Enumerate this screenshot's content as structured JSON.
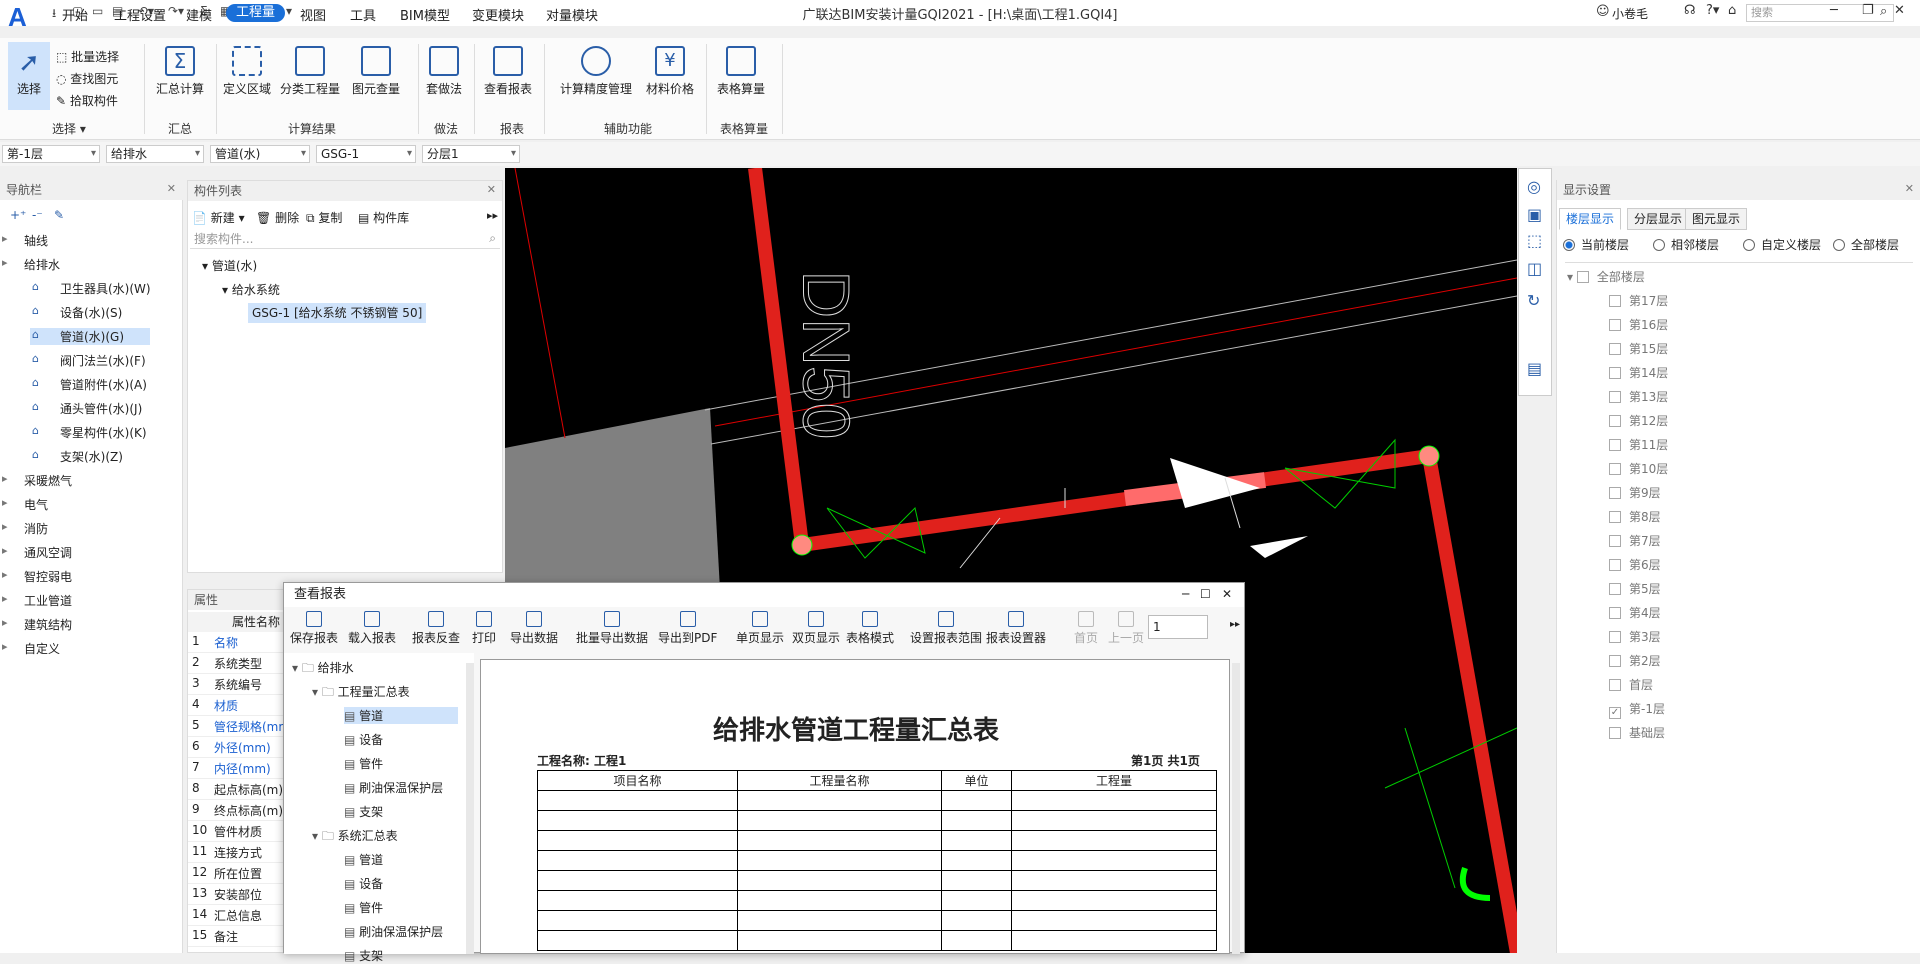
{
  "app": {
    "title": "广联达BIM安装计量GQI2021 - [H:\\桌面\\工程1.GQI4]",
    "logo": "A",
    "user": "小卷毛",
    "search_placeholder": "搜索"
  },
  "menu": [
    "开始",
    "工程设置",
    "建模",
    "工程量",
    "视图",
    "工具",
    "BIM模型",
    "变更模块",
    "对量模块"
  ],
  "menu_active": 3,
  "ribbon": {
    "select": {
      "big": "选择",
      "small": [
        "批量选择",
        "查找图元",
        "拾取构件"
      ],
      "group": "选择"
    },
    "summary": {
      "big": "汇总计算",
      "group": "汇总"
    },
    "results": {
      "items": [
        "定义区域",
        "分类工程量",
        "图元查量"
      ],
      "group": "计算结果"
    },
    "method": {
      "items": [
        "套做法"
      ],
      "group": "做法"
    },
    "report": {
      "items": [
        "查看报表"
      ],
      "group": "报表"
    },
    "aux": {
      "items": [
        "计算精度管理",
        "材料价格"
      ],
      "group": "辅助功能"
    },
    "table": {
      "items": [
        "表格算量"
      ],
      "group": "表格算量"
    }
  },
  "propbar": [
    "第-1层",
    "给排水",
    "管道(水)",
    "GSG-1",
    "分层1"
  ],
  "nav": {
    "title": "导航栏",
    "items": [
      {
        "label": "轴线",
        "level": 0
      },
      {
        "label": "给排水",
        "level": 0
      },
      {
        "label": "卫生器具(水)(W)",
        "level": 1
      },
      {
        "label": "设备(水)(S)",
        "level": 1
      },
      {
        "label": "管道(水)(G)",
        "level": 1,
        "selected": true
      },
      {
        "label": "阀门法兰(水)(F)",
        "level": 1
      },
      {
        "label": "管道附件(水)(A)",
        "level": 1
      },
      {
        "label": "通头管件(水)(J)",
        "level": 1
      },
      {
        "label": "零星构件(水)(K)",
        "level": 1
      },
      {
        "label": "支架(水)(Z)",
        "level": 1
      },
      {
        "label": "采暖燃气",
        "level": 0
      },
      {
        "label": "电气",
        "level": 0
      },
      {
        "label": "消防",
        "level": 0
      },
      {
        "label": "通风空调",
        "level": 0
      },
      {
        "label": "智控弱电",
        "level": 0
      },
      {
        "label": "工业管道",
        "level": 0
      },
      {
        "label": "建筑结构",
        "level": 0
      },
      {
        "label": "自定义",
        "level": 0
      }
    ]
  },
  "components": {
    "title": "构件列表",
    "toolbar": [
      "新建",
      "删除",
      "复制",
      "构件库"
    ],
    "search_placeholder": "搜索构件...",
    "tree": [
      "管道(水)",
      "给水系统",
      "GSG-1 [给水系统 不锈钢管 50]"
    ]
  },
  "properties": {
    "title": "属性",
    "header": "属性名称",
    "rows": [
      {
        "n": "1",
        "name": "名称",
        "blue": true
      },
      {
        "n": "2",
        "name": "系统类型"
      },
      {
        "n": "3",
        "name": "系统编号"
      },
      {
        "n": "4",
        "name": "材质",
        "blue": true
      },
      {
        "n": "5",
        "name": "管径规格(mm",
        "blue": true
      },
      {
        "n": "6",
        "name": "外径(mm)",
        "blue": true
      },
      {
        "n": "7",
        "name": "内径(mm)",
        "blue": true
      },
      {
        "n": "8",
        "name": "起点标高(m)"
      },
      {
        "n": "9",
        "name": "终点标高(m)"
      },
      {
        "n": "10",
        "name": "管件材质"
      },
      {
        "n": "11",
        "name": "连接方式"
      },
      {
        "n": "12",
        "name": "所在位置"
      },
      {
        "n": "13",
        "name": "安装部位"
      },
      {
        "n": "14",
        "name": "汇总信息"
      },
      {
        "n": "15",
        "name": "备注"
      }
    ]
  },
  "canvas": {
    "labels": [
      "DN50"
    ]
  },
  "display": {
    "title": "显示设置",
    "tabs": [
      "楼层显示",
      "分层显示",
      "图元显示"
    ],
    "radios": [
      "当前楼层",
      "相邻楼层",
      "自定义楼层",
      "全部楼层"
    ],
    "all_floors": "全部楼层",
    "floors": [
      "第17层",
      "第16层",
      "第15层",
      "第14层",
      "第13层",
      "第12层",
      "第11层",
      "第10层",
      "第9层",
      "第8层",
      "第7层",
      "第6层",
      "第5层",
      "第4层",
      "第3层",
      "第2层",
      "首层",
      "第-1层",
      "基础层"
    ],
    "checked": "第-1层"
  },
  "report": {
    "title": "查看报表",
    "toolbar": [
      "保存报表",
      "载入报表",
      "报表反查",
      "打印",
      "导出数据",
      "批量导出数据",
      "导出到PDF",
      "单页显示",
      "双页显示",
      "表格模式",
      "设置报表范围",
      "报表设置器",
      "首页",
      "上一页"
    ],
    "page": "1",
    "tree": [
      {
        "label": "给排水",
        "level": 0,
        "folder": true
      },
      {
        "label": "工程量汇总表",
        "level": 1,
        "folder": true
      },
      {
        "label": "管道",
        "level": 2,
        "selected": true
      },
      {
        "label": "设备",
        "level": 2
      },
      {
        "label": "管件",
        "level": 2
      },
      {
        "label": "刷油保温保护层",
        "level": 2
      },
      {
        "label": "支架",
        "level": 2
      },
      {
        "label": "系统汇总表",
        "level": 1,
        "folder": true
      },
      {
        "label": "管道",
        "level": 2
      },
      {
        "label": "设备",
        "level": 2
      },
      {
        "label": "管件",
        "level": 2
      },
      {
        "label": "刷油保温保护层",
        "level": 2
      },
      {
        "label": "支架",
        "level": 2
      }
    ],
    "sheet_title": "给排水管道工程量汇总表",
    "project": "工程名称: 工程1",
    "pageinfo": "第1页  共1页",
    "cols": [
      "项目名称",
      "工程量名称",
      "单位",
      "工程量"
    ]
  }
}
